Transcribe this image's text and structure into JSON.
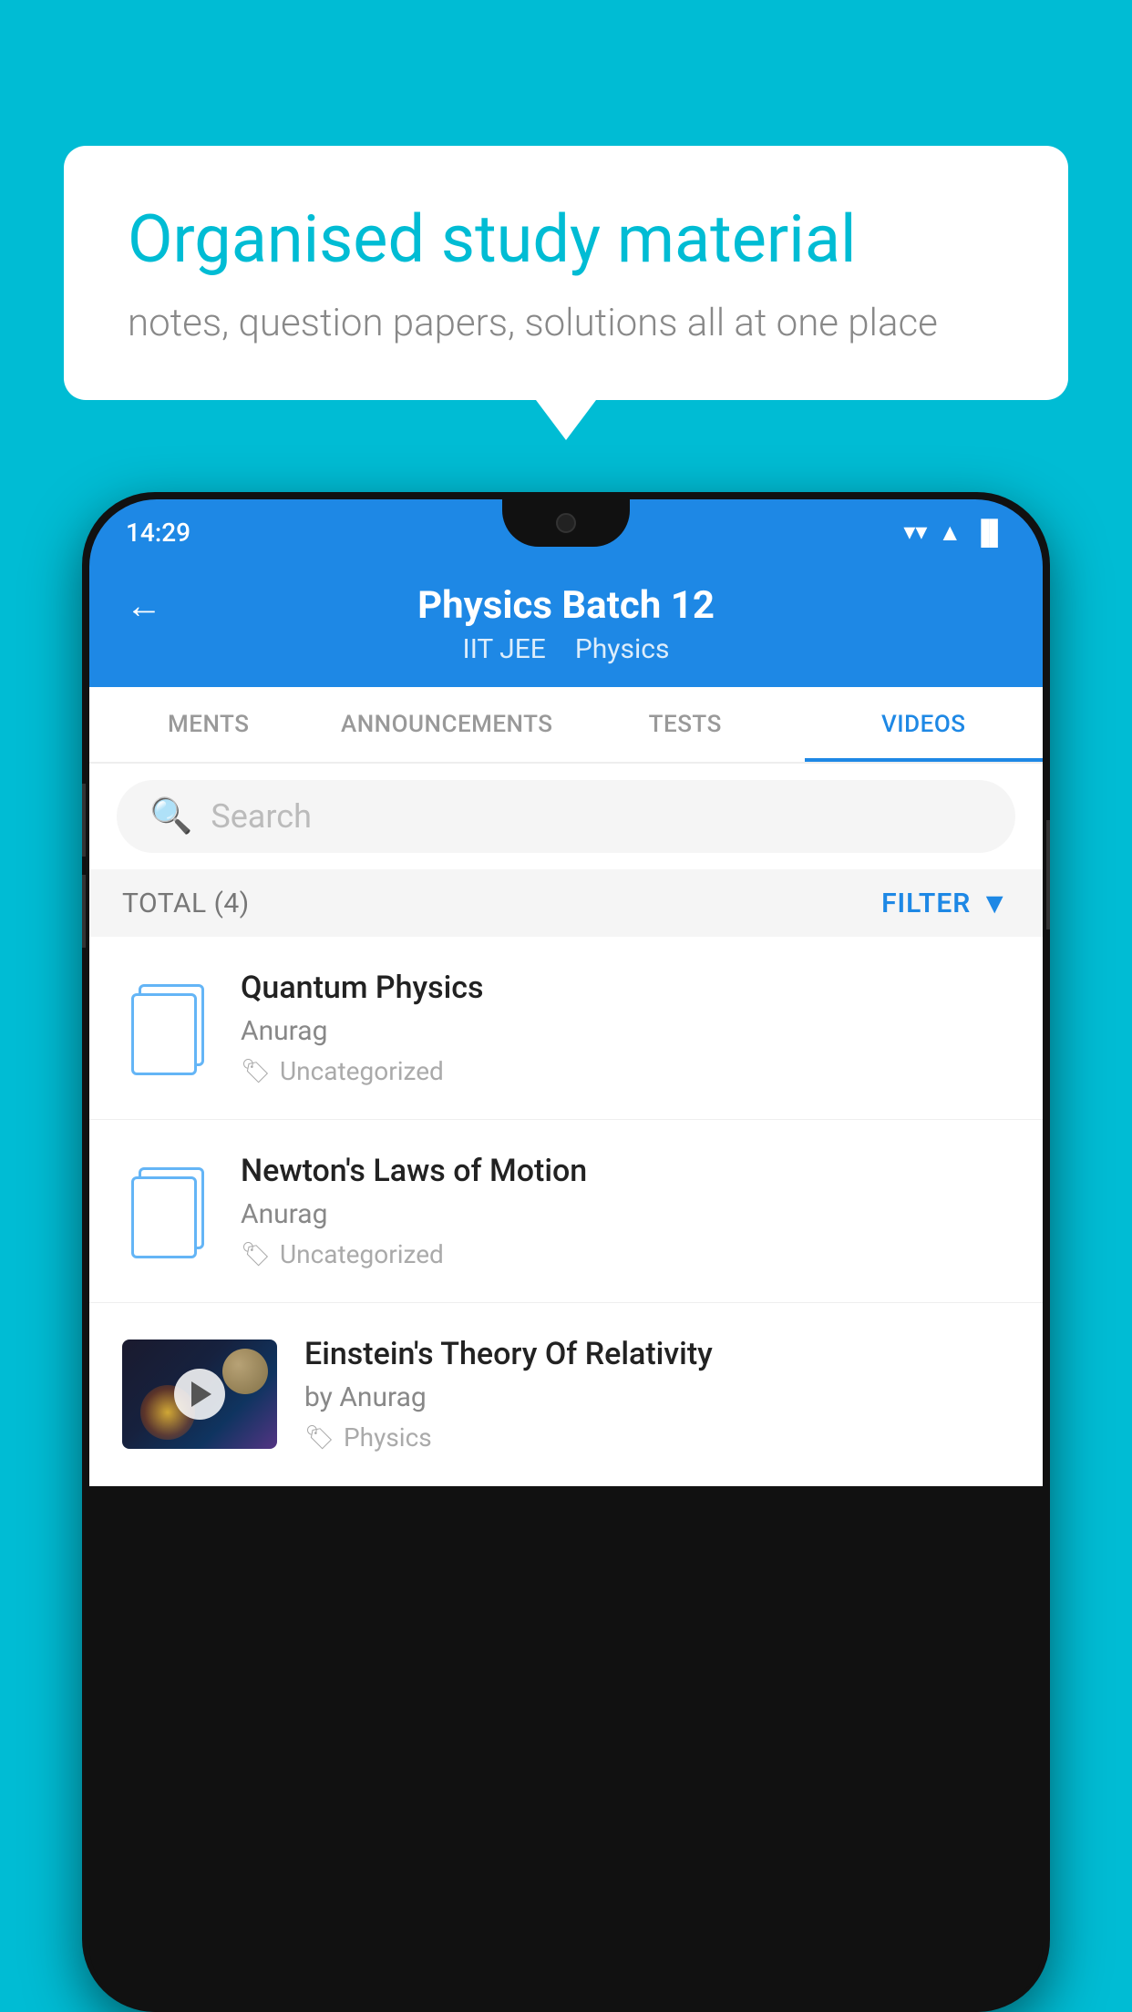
{
  "background_color": "#00BCD4",
  "bubble": {
    "title": "Organised study material",
    "subtitle": "notes, question papers, solutions all at one place"
  },
  "status_bar": {
    "time": "14:29",
    "wifi_icon": "▼",
    "signal_icon": "▲",
    "battery_icon": "▌"
  },
  "header": {
    "back_label": "←",
    "title": "Physics Batch 12",
    "breadcrumb1": "IIT JEE",
    "breadcrumb2": "Physics"
  },
  "tabs": [
    {
      "label": "MENTS",
      "active": false
    },
    {
      "label": "ANNOUNCEMENTS",
      "active": false
    },
    {
      "label": "TESTS",
      "active": false
    },
    {
      "label": "VIDEOS",
      "active": true
    }
  ],
  "search": {
    "placeholder": "Search"
  },
  "filter_row": {
    "total_label": "TOTAL (4)",
    "filter_label": "FILTER"
  },
  "videos": [
    {
      "id": "quantum-physics",
      "title": "Quantum Physics",
      "author": "Anurag",
      "tag": "Uncategorized",
      "has_thumb": false
    },
    {
      "id": "newtons-laws",
      "title": "Newton's Laws of Motion",
      "author": "Anurag",
      "tag": "Uncategorized",
      "has_thumb": false
    },
    {
      "id": "einstein-relativity",
      "title": "Einstein's Theory Of Relativity",
      "author": "by Anurag",
      "tag": "Physics",
      "has_thumb": true
    }
  ]
}
